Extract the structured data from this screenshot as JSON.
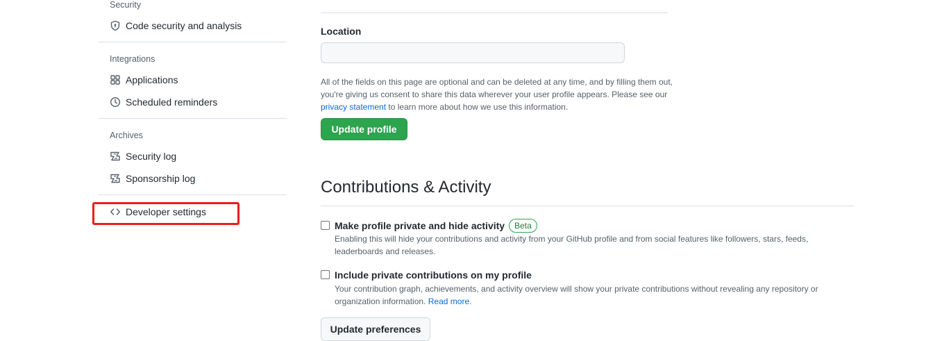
{
  "sidebar": {
    "sections": {
      "security": {
        "heading": "Security",
        "items": [
          {
            "label": "Code security and analysis",
            "icon": "shield-icon"
          }
        ]
      },
      "integrations": {
        "heading": "Integrations",
        "items": [
          {
            "label": "Applications",
            "icon": "apps-grid-icon"
          },
          {
            "label": "Scheduled reminders",
            "icon": "clock-icon"
          }
        ]
      },
      "archives": {
        "heading": "Archives",
        "items": [
          {
            "label": "Security log",
            "icon": "log-icon"
          },
          {
            "label": "Sponsorship log",
            "icon": "log-icon"
          }
        ]
      }
    },
    "developer_settings": {
      "label": "Developer settings",
      "icon": "code-icon"
    },
    "highlight_color": "#ee1c1c"
  },
  "main": {
    "location": {
      "label": "Location",
      "value": ""
    },
    "consent": {
      "text_before": "All of the fields on this page are optional and can be deleted at any time, and by filling them out, you're giving us consent to share this data wherever your user profile appears. Please see our ",
      "link": "privacy statement",
      "text_after": " to learn more about how we use this information."
    },
    "update_profile_button": "Update profile",
    "contributions": {
      "title": "Contributions & Activity",
      "private_profile": {
        "label": "Make profile private and hide activity",
        "badge": "Beta",
        "description": "Enabling this will hide your contributions and activity from your GitHub profile and from social features like followers, stars, feeds, leaderboards and releases.",
        "checked": false
      },
      "private_contributions": {
        "label": "Include private contributions on my profile",
        "description": "Your contribution graph, achievements, and activity overview will show your private contributions without revealing any repository or organization information. ",
        "link": "Read more.",
        "checked": false
      },
      "update_preferences_button": "Update preferences"
    }
  },
  "colors": {
    "primary_button": "#2da44e",
    "link": "#0969da",
    "muted_text": "#57606a",
    "border": "#d0d7de"
  }
}
